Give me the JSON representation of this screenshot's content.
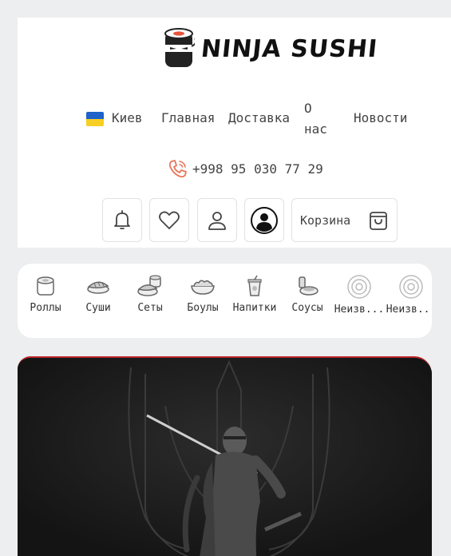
{
  "header": {
    "logo_text": "NINJA SUSHI",
    "nav": {
      "city": "Киев",
      "home": "Главная",
      "delivery": "Доставка",
      "about_line1": "О",
      "about_line2": "нас",
      "news": "Новости"
    },
    "phone": "+998 95 030 77 29",
    "icons": [
      "bell-icon",
      "heart-icon",
      "user-icon",
      "account-circle-icon"
    ],
    "cart_label": "Корзина"
  },
  "categories": [
    {
      "label": "Роллы",
      "icon": "roll-icon"
    },
    {
      "label": "Суши",
      "icon": "sushi-icon"
    },
    {
      "label": "Сеты",
      "icon": "set-icon"
    },
    {
      "label": "Боулы",
      "icon": "bowl-icon"
    },
    {
      "label": "Напитки",
      "icon": "drink-icon"
    },
    {
      "label": "Соусы",
      "icon": "sauce-icon"
    },
    {
      "label": "Неизв...",
      "icon": "unknown-icon"
    },
    {
      "label": "Неизв...",
      "icon": "unknown-icon"
    }
  ],
  "colors": {
    "accent": "#b8262a",
    "phone_icon": "#e8755a",
    "flag_blue": "#1f62c8",
    "flag_yellow": "#f7cf22"
  }
}
